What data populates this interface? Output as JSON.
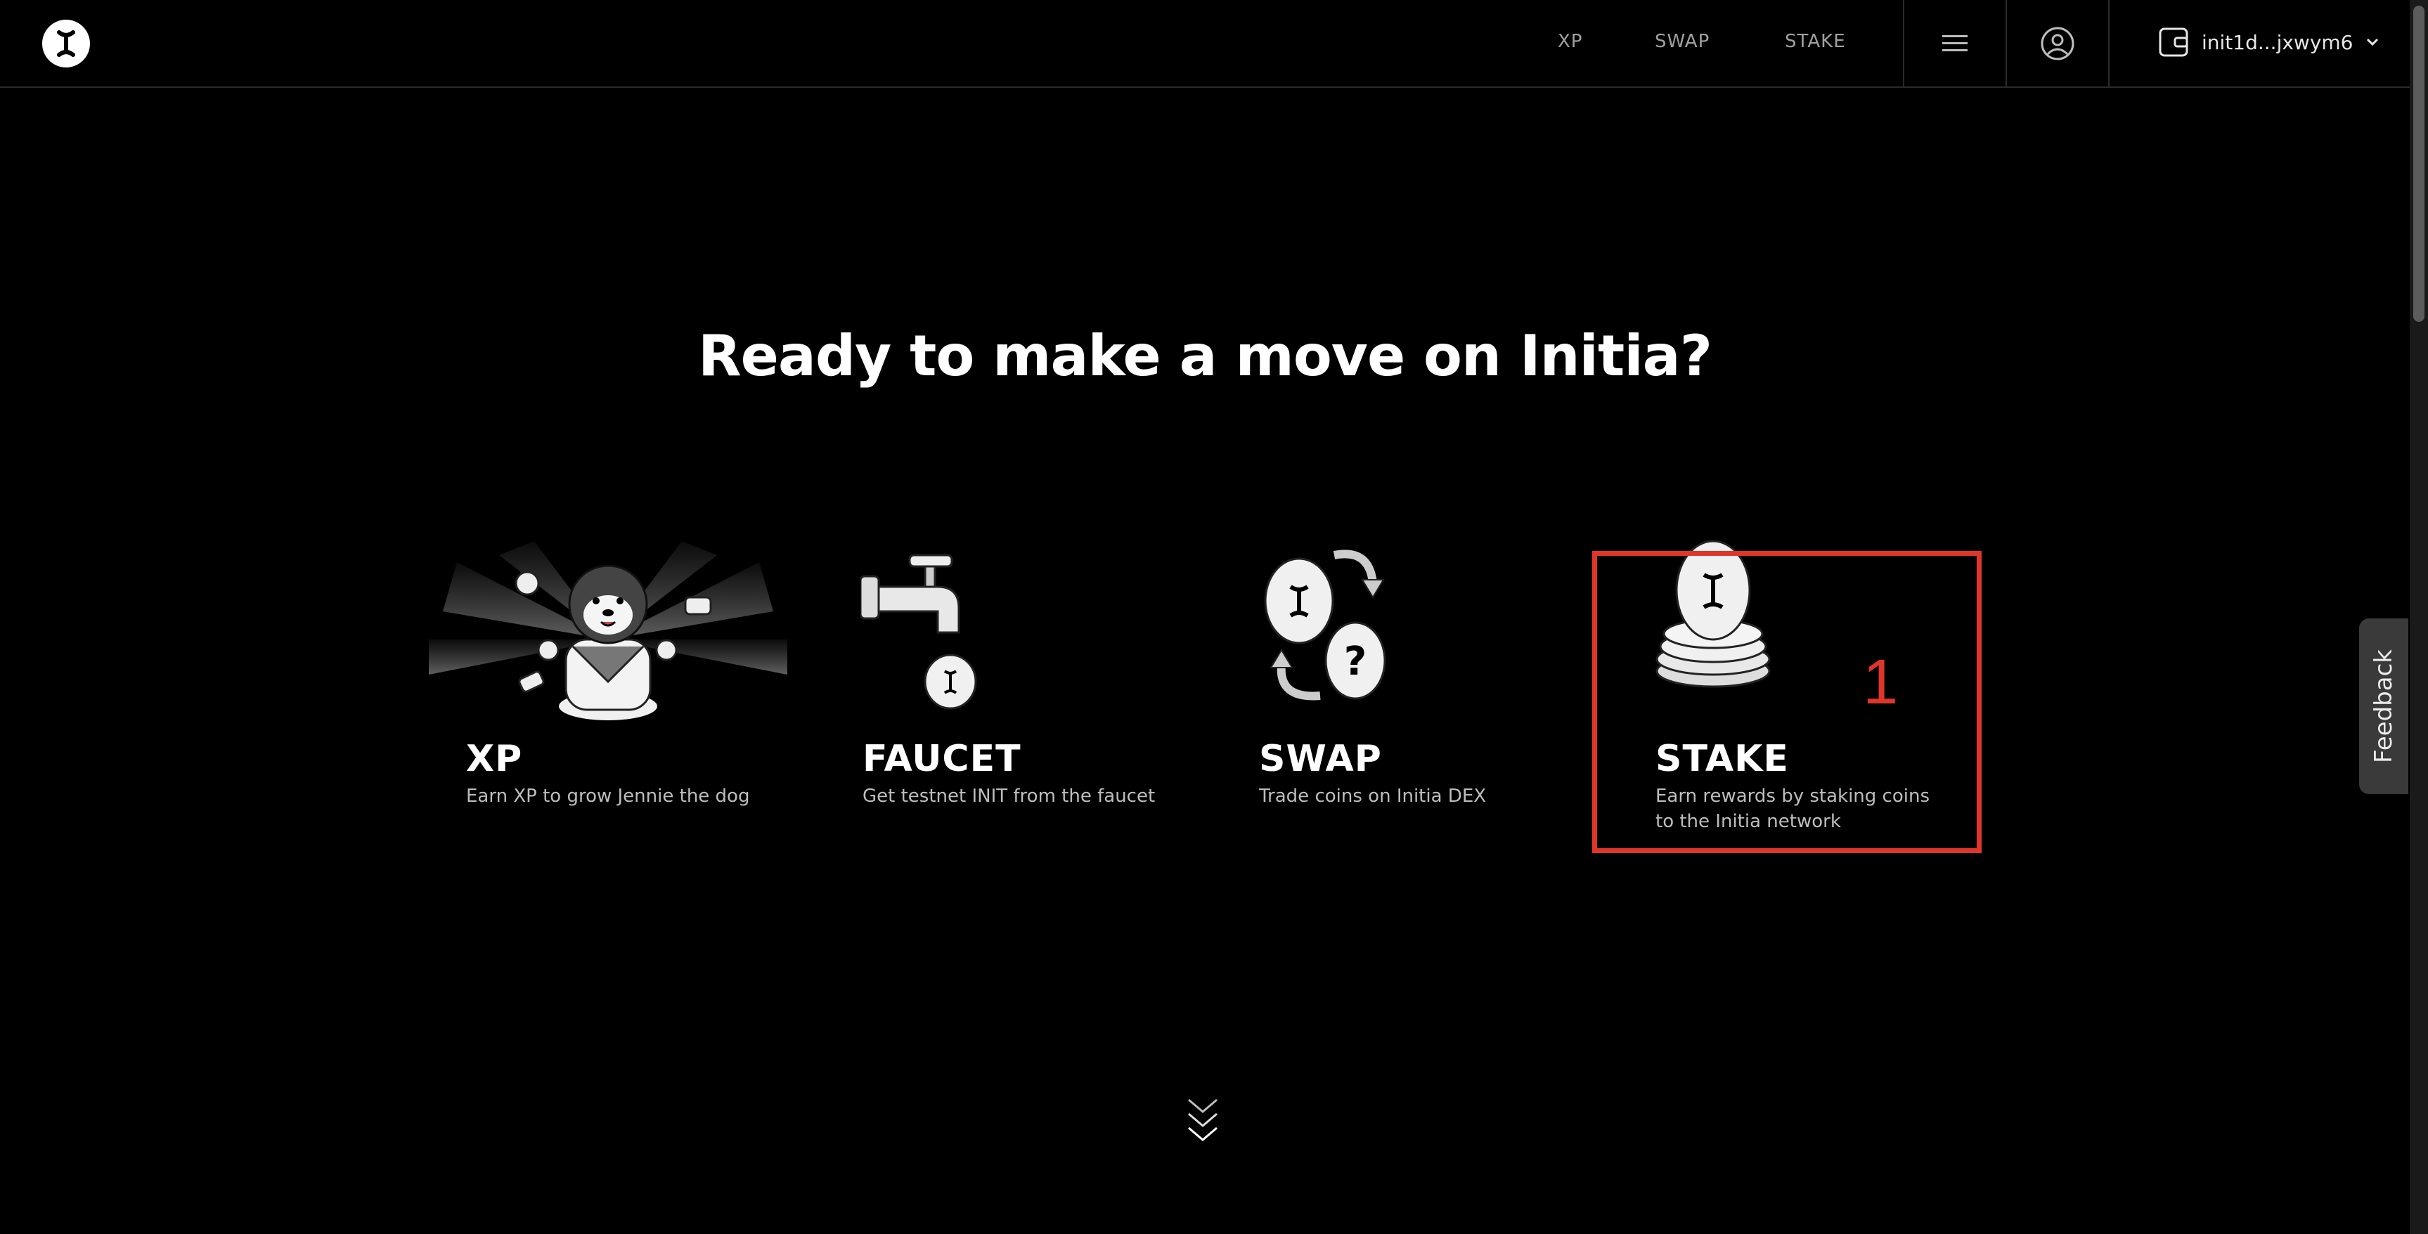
{
  "header": {
    "nav": [
      {
        "label": "XP"
      },
      {
        "label": "SWAP"
      },
      {
        "label": "STAKE"
      }
    ],
    "wallet_address": "init1d...jxwym6"
  },
  "hero": {
    "title": "Ready to make a move on Initia?"
  },
  "cards": [
    {
      "title": "XP",
      "description": "Earn XP to grow Jennie the dog"
    },
    {
      "title": "FAUCET",
      "description": "Get testnet INIT from the faucet"
    },
    {
      "title": "SWAP",
      "description": "Trade coins on Initia DEX"
    },
    {
      "title": "STAKE",
      "description": "Earn rewards by staking coins to the Initia network"
    }
  ],
  "annotation": {
    "marker_label": "1",
    "color": "#e0362a"
  },
  "feedback": {
    "label": "Feedback"
  },
  "icons": [
    "initia-logo-icon",
    "menu-icon",
    "user-icon",
    "wallet-icon",
    "chevron-down-icon",
    "scroll-down-icon"
  ]
}
